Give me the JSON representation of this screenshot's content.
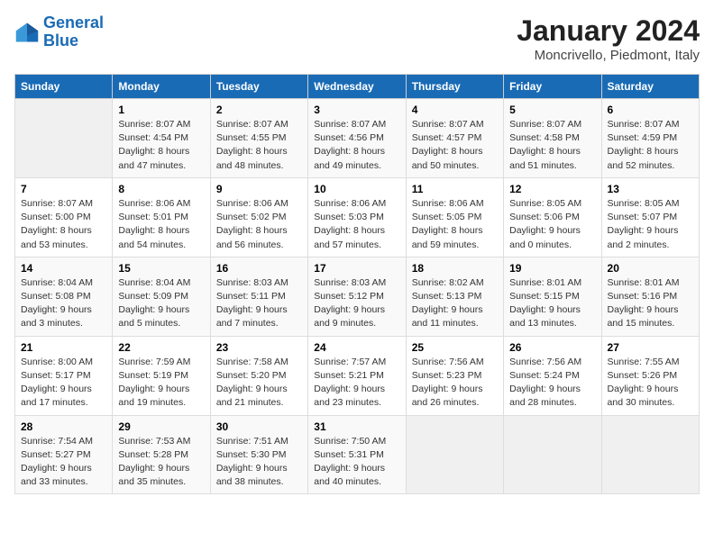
{
  "logo": {
    "line1": "General",
    "line2": "Blue"
  },
  "title": "January 2024",
  "subtitle": "Moncrivello, Piedmont, Italy",
  "header_days": [
    "Sunday",
    "Monday",
    "Tuesday",
    "Wednesday",
    "Thursday",
    "Friday",
    "Saturday"
  ],
  "weeks": [
    [
      {
        "num": "",
        "info": ""
      },
      {
        "num": "1",
        "info": "Sunrise: 8:07 AM\nSunset: 4:54 PM\nDaylight: 8 hours\nand 47 minutes."
      },
      {
        "num": "2",
        "info": "Sunrise: 8:07 AM\nSunset: 4:55 PM\nDaylight: 8 hours\nand 48 minutes."
      },
      {
        "num": "3",
        "info": "Sunrise: 8:07 AM\nSunset: 4:56 PM\nDaylight: 8 hours\nand 49 minutes."
      },
      {
        "num": "4",
        "info": "Sunrise: 8:07 AM\nSunset: 4:57 PM\nDaylight: 8 hours\nand 50 minutes."
      },
      {
        "num": "5",
        "info": "Sunrise: 8:07 AM\nSunset: 4:58 PM\nDaylight: 8 hours\nand 51 minutes."
      },
      {
        "num": "6",
        "info": "Sunrise: 8:07 AM\nSunset: 4:59 PM\nDaylight: 8 hours\nand 52 minutes."
      }
    ],
    [
      {
        "num": "7",
        "info": "Sunrise: 8:07 AM\nSunset: 5:00 PM\nDaylight: 8 hours\nand 53 minutes."
      },
      {
        "num": "8",
        "info": "Sunrise: 8:06 AM\nSunset: 5:01 PM\nDaylight: 8 hours\nand 54 minutes."
      },
      {
        "num": "9",
        "info": "Sunrise: 8:06 AM\nSunset: 5:02 PM\nDaylight: 8 hours\nand 56 minutes."
      },
      {
        "num": "10",
        "info": "Sunrise: 8:06 AM\nSunset: 5:03 PM\nDaylight: 8 hours\nand 57 minutes."
      },
      {
        "num": "11",
        "info": "Sunrise: 8:06 AM\nSunset: 5:05 PM\nDaylight: 8 hours\nand 59 minutes."
      },
      {
        "num": "12",
        "info": "Sunrise: 8:05 AM\nSunset: 5:06 PM\nDaylight: 9 hours\nand 0 minutes."
      },
      {
        "num": "13",
        "info": "Sunrise: 8:05 AM\nSunset: 5:07 PM\nDaylight: 9 hours\nand 2 minutes."
      }
    ],
    [
      {
        "num": "14",
        "info": "Sunrise: 8:04 AM\nSunset: 5:08 PM\nDaylight: 9 hours\nand 3 minutes."
      },
      {
        "num": "15",
        "info": "Sunrise: 8:04 AM\nSunset: 5:09 PM\nDaylight: 9 hours\nand 5 minutes."
      },
      {
        "num": "16",
        "info": "Sunrise: 8:03 AM\nSunset: 5:11 PM\nDaylight: 9 hours\nand 7 minutes."
      },
      {
        "num": "17",
        "info": "Sunrise: 8:03 AM\nSunset: 5:12 PM\nDaylight: 9 hours\nand 9 minutes."
      },
      {
        "num": "18",
        "info": "Sunrise: 8:02 AM\nSunset: 5:13 PM\nDaylight: 9 hours\nand 11 minutes."
      },
      {
        "num": "19",
        "info": "Sunrise: 8:01 AM\nSunset: 5:15 PM\nDaylight: 9 hours\nand 13 minutes."
      },
      {
        "num": "20",
        "info": "Sunrise: 8:01 AM\nSunset: 5:16 PM\nDaylight: 9 hours\nand 15 minutes."
      }
    ],
    [
      {
        "num": "21",
        "info": "Sunrise: 8:00 AM\nSunset: 5:17 PM\nDaylight: 9 hours\nand 17 minutes."
      },
      {
        "num": "22",
        "info": "Sunrise: 7:59 AM\nSunset: 5:19 PM\nDaylight: 9 hours\nand 19 minutes."
      },
      {
        "num": "23",
        "info": "Sunrise: 7:58 AM\nSunset: 5:20 PM\nDaylight: 9 hours\nand 21 minutes."
      },
      {
        "num": "24",
        "info": "Sunrise: 7:57 AM\nSunset: 5:21 PM\nDaylight: 9 hours\nand 23 minutes."
      },
      {
        "num": "25",
        "info": "Sunrise: 7:56 AM\nSunset: 5:23 PM\nDaylight: 9 hours\nand 26 minutes."
      },
      {
        "num": "26",
        "info": "Sunrise: 7:56 AM\nSunset: 5:24 PM\nDaylight: 9 hours\nand 28 minutes."
      },
      {
        "num": "27",
        "info": "Sunrise: 7:55 AM\nSunset: 5:26 PM\nDaylight: 9 hours\nand 30 minutes."
      }
    ],
    [
      {
        "num": "28",
        "info": "Sunrise: 7:54 AM\nSunset: 5:27 PM\nDaylight: 9 hours\nand 33 minutes."
      },
      {
        "num": "29",
        "info": "Sunrise: 7:53 AM\nSunset: 5:28 PM\nDaylight: 9 hours\nand 35 minutes."
      },
      {
        "num": "30",
        "info": "Sunrise: 7:51 AM\nSunset: 5:30 PM\nDaylight: 9 hours\nand 38 minutes."
      },
      {
        "num": "31",
        "info": "Sunrise: 7:50 AM\nSunset: 5:31 PM\nDaylight: 9 hours\nand 40 minutes."
      },
      {
        "num": "",
        "info": ""
      },
      {
        "num": "",
        "info": ""
      },
      {
        "num": "",
        "info": ""
      }
    ]
  ]
}
